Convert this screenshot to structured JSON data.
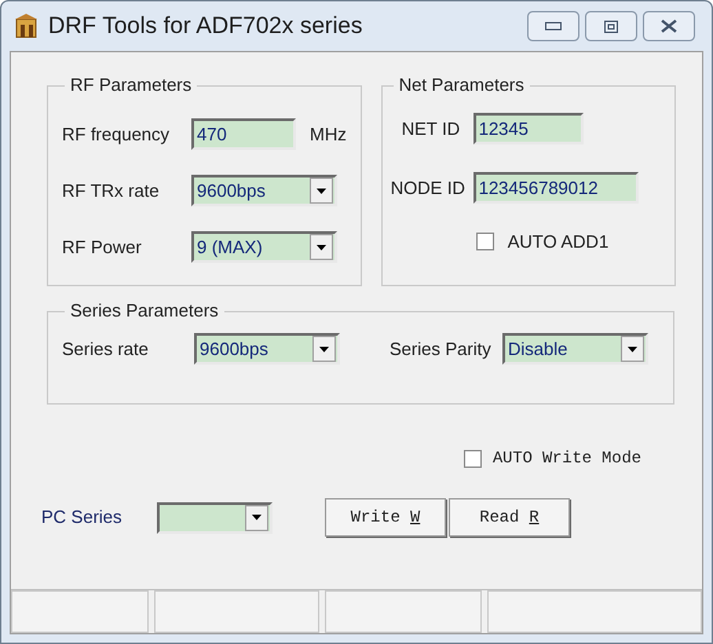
{
  "window": {
    "title": "DRF Tools for ADF702x series"
  },
  "rf_parameters": {
    "title": "RF Parameters",
    "fields": [
      {
        "kind": "text",
        "label": "RF frequency",
        "value": "470",
        "unit": "MHz"
      },
      {
        "kind": "combo",
        "label": "RF TRx rate",
        "value": "9600bps"
      },
      {
        "kind": "combo",
        "label": "RF Power",
        "value": "9 (MAX)"
      }
    ]
  },
  "net_parameters": {
    "title": "Net Parameters",
    "fields": [
      {
        "kind": "text",
        "label": "NET ID",
        "value": "12345"
      },
      {
        "kind": "text",
        "label": "NODE ID",
        "value": "123456789012"
      }
    ],
    "auto_add": {
      "label": "AUTO ADD1",
      "checked": false
    }
  },
  "series_parameters": {
    "title": "Series Parameters",
    "fields": [
      {
        "kind": "combo",
        "label": "Series rate",
        "value": "9600bps"
      },
      {
        "kind": "combo",
        "label": "Series Parity",
        "value": "Disable"
      }
    ]
  },
  "auto_write_mode": {
    "label": "AUTO Write Mode",
    "checked": false
  },
  "pc_series": {
    "label": "PC Series"
  },
  "buttons": [
    {
      "label": "Write",
      "accelerator": "W"
    },
    {
      "label": "Read",
      "accelerator": "R"
    }
  ]
}
